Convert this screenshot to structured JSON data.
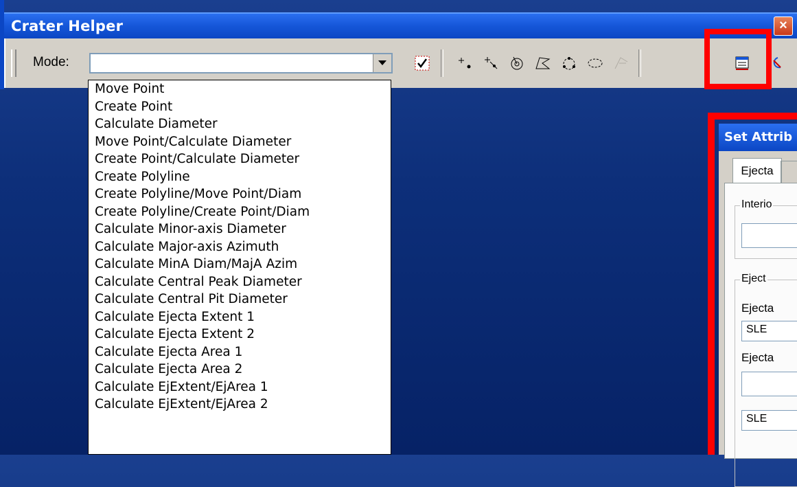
{
  "window": {
    "title": "Crater Helper"
  },
  "toolbar": {
    "mode_label": "Mode:",
    "mode_value": ""
  },
  "dropdown": {
    "items": [
      "Move Point",
      "Create Point",
      "Calculate Diameter",
      "Move Point/Calculate Diameter",
      "Create Point/Calculate Diameter",
      "Create Polyline",
      "Create Polyline/Move Point/Diam",
      "Create Polyline/Create Point/Diam",
      "Calculate Minor-axis Diameter",
      "Calculate Major-axis Azimuth",
      "Calculate MinA Diam/MajA Azim",
      "Calculate Central Peak Diameter",
      "Calculate Central Pit Diameter",
      "Calculate Ejecta Extent 1",
      "Calculate Ejecta Extent 2",
      "Calculate Ejecta Area 1",
      "Calculate Ejecta Area 2",
      "Calculate EjExtent/EjArea 1",
      "Calculate EjExtent/EjArea 2"
    ]
  },
  "dialog": {
    "title": "Set Attrib",
    "tab_ejecta": "Ejecta",
    "group_interior": "Interio",
    "group_ejecta": "Eject",
    "label_ejecta_1": "Ejecta",
    "value_1": "SLE",
    "label_ejecta_2": "Ejecta",
    "value_2": "SLE"
  },
  "colors": {
    "highlight": "#ff0000",
    "titlebar": "#0b46c4"
  }
}
